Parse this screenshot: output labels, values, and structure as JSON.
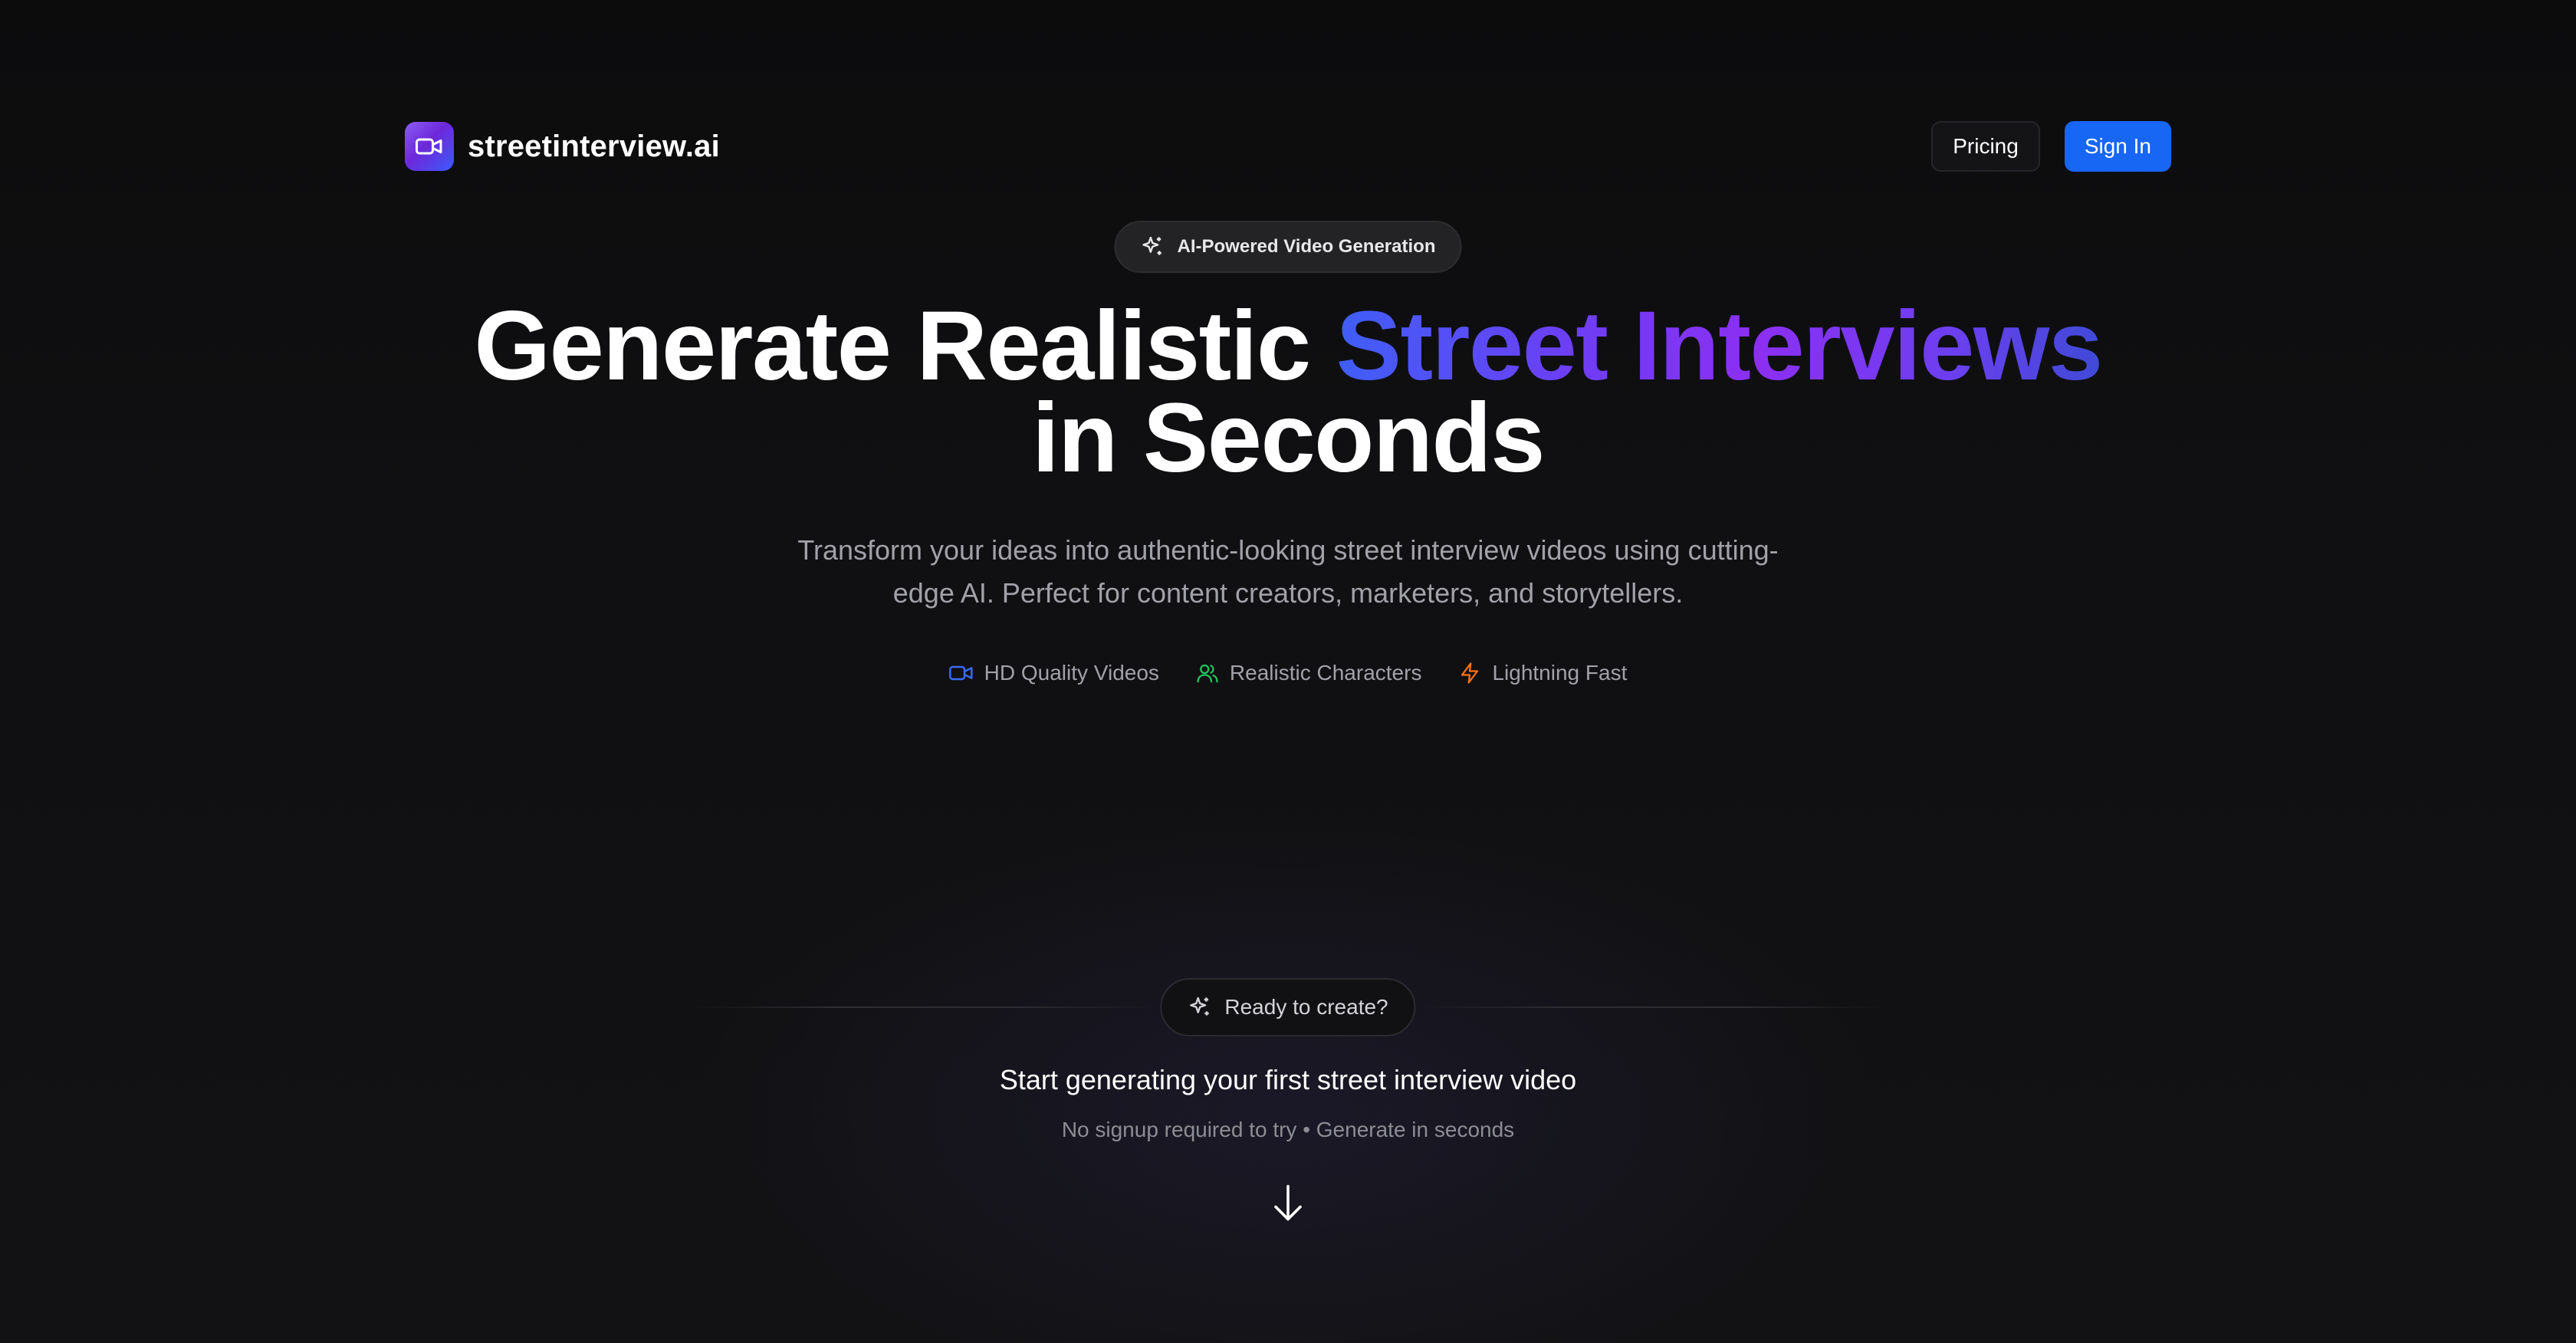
{
  "nav": {
    "brand_name": "streetinterview.ai",
    "pricing_label": "Pricing",
    "signin_label": "Sign In"
  },
  "hero": {
    "badge_text": "AI-Powered Video Generation",
    "headline_part1": "Generate Realistic ",
    "headline_highlight": "Street Interviews",
    "headline_part2": "in Seconds",
    "subtitle": "Transform your ideas into authentic-looking street interview videos using cutting-edge AI. Perfect for content creators, marketers, and storytellers.",
    "features": [
      {
        "label": "HD Quality Videos",
        "icon": "video-icon",
        "color": "#3b6cf6"
      },
      {
        "label": "Realistic Characters",
        "icon": "users-icon",
        "color": "#22c55e"
      },
      {
        "label": "Lightning Fast",
        "icon": "zap-icon",
        "color": "#f97316"
      }
    ]
  },
  "cta": {
    "pill_text": "Ready to create?",
    "title": "Start generating your first street interview video",
    "subtitle": "No signup required to try • Generate in seconds",
    "arrow_icon": "arrow-down-icon"
  },
  "colors": {
    "accent_blue": "#1766f4",
    "gradient_start": "#3f5ff7",
    "gradient_mid": "#8c2ff2",
    "background": "#0e0e10"
  }
}
